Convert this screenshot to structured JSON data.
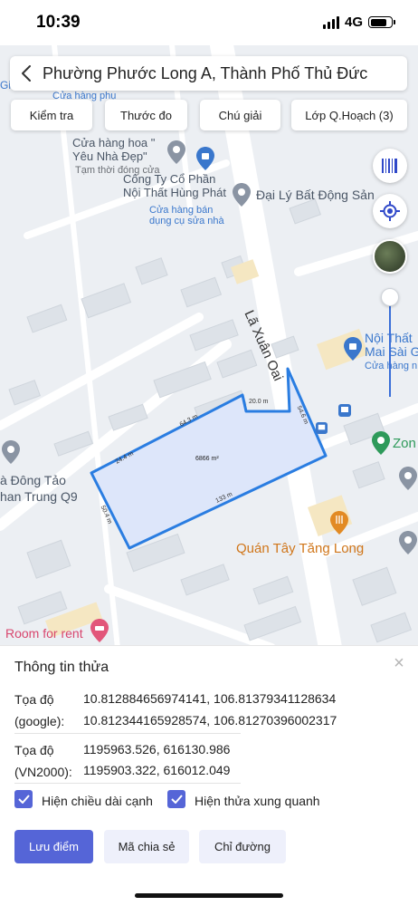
{
  "status_bar": {
    "time": "10:39",
    "network": "4G"
  },
  "search": {
    "text": "Phường Phước Long A, Thành Phố Thủ Đức"
  },
  "toolbar": {
    "check": "Kiểm tra",
    "measure": "Thước đo",
    "legend": "Chú giải",
    "layers": "Lớp Q.Hoạch (3)"
  },
  "map": {
    "road": "Lã Xuân Oai",
    "pois": {
      "flower_shop_1": "Cửa hàng hoa \"",
      "flower_shop_2": "Yêu Nhà Đẹp\"",
      "flower_shop_status": "Tạm thời đóng cửa",
      "furniture_1": "Công Ty Cổ Phần",
      "furniture_2": "Nội Thất Hùng Phát",
      "furniture_sub_1": "Cửa hàng bán",
      "furniture_sub_2": "dụng cụ sửa nhà",
      "real_estate": "Đại Lý Bất Động Sản",
      "top_left_partial": "Gi",
      "top_partial": "Cửa hàng phụ",
      "noi_that_1": "Nội Thất",
      "noi_that_2": "Mai Sài G",
      "noi_that_sub": "Cửa hàng n",
      "zone": "Zon",
      "dong_tao_1": "à Đông Tảo",
      "dong_tao_2": "han Trung Q9",
      "quan_tay": "Quán Tây Tăng Long",
      "room": "Room for rent"
    },
    "parcel": {
      "area": "6866 m²",
      "edges": {
        "top_left": "24.4 m",
        "top_mid": "64.3 m",
        "top_right": "20.0 m",
        "right": "54.6 m",
        "bottom": "133 m",
        "left": "50.4 m"
      }
    }
  },
  "panel": {
    "title": "Thông tin thửa",
    "google_label_1": "Tọa độ",
    "google_label_2": "(google):",
    "google_value_1": "10.812884656974141, 106.81379341128634",
    "google_value_2": "10.812344165928574, 106.81270396002317",
    "vn_label_1": "Tọa độ",
    "vn_label_2": "(VN2000):",
    "vn_value_1": "1195963.526, 616130.986",
    "vn_value_2": "1195903.322, 616012.049",
    "checkbox_edges": "Hiện chiều dài cạnh",
    "checkbox_around": "Hiện thửa xung quanh",
    "save_button": "Lưu điểm",
    "share_button": "Mã chia sẻ",
    "directions_button": "Chỉ đường",
    "close": "×"
  },
  "colors": {
    "accent": "#5565d7",
    "parcel_stroke": "#2a7de1",
    "parcel_fill": "#dde6fa",
    "map_bg": "#eceff3"
  }
}
